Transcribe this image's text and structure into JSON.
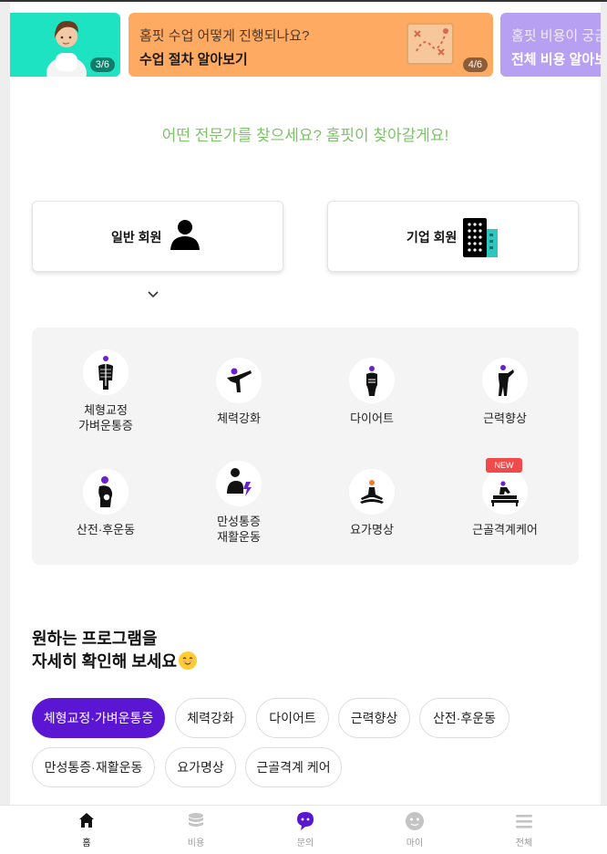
{
  "banners": [
    {
      "subtitle": "",
      "title": "",
      "pager": "3/6"
    },
    {
      "subtitle": "홈핏 수업 어떻게 진행되나요?",
      "title": "수업 절차 알아보기",
      "pager": "4/6"
    },
    {
      "subtitle": "홈핏 비용이 궁금",
      "title": "전체 비용 알아보",
      "pager": ""
    }
  ],
  "tagline": "어떤 전문가를 찾으세요? 홈핏이 찾아갈게요!",
  "member_types": [
    {
      "label": "일반 회원",
      "icon": "person-icon"
    },
    {
      "label": "기업 회원",
      "icon": "building-icon"
    }
  ],
  "categories": [
    {
      "label_line1": "체형교정",
      "label_line2": "가벼운통증",
      "icon": "posture-icon"
    },
    {
      "label_line1": "체력강화",
      "label_line2": "",
      "icon": "strength-icon"
    },
    {
      "label_line1": "다이어트",
      "label_line2": "",
      "icon": "diet-icon"
    },
    {
      "label_line1": "근력향상",
      "label_line2": "",
      "icon": "muscle-icon"
    },
    {
      "label_line1": "산전·후운동",
      "label_line2": "",
      "icon": "prenatal-icon"
    },
    {
      "label_line1": "만성통증",
      "label_line2": "재활운동",
      "icon": "chronic-pain-icon"
    },
    {
      "label_line1": "요가명상",
      "label_line2": "",
      "icon": "yoga-icon"
    },
    {
      "label_line1": "근골격계케어",
      "label_line2": "",
      "icon": "massage-icon",
      "badge": "NEW"
    }
  ],
  "program_section": {
    "title_line1": "원하는 프로그램을",
    "title_line2": "자세히 확인해 보세요"
  },
  "chips": [
    {
      "label": "체형교정·가벼운통증",
      "active": true
    },
    {
      "label": "체력강화"
    },
    {
      "label": "다이어트"
    },
    {
      "label": "근력향상"
    },
    {
      "label": "산전·후운동"
    },
    {
      "label": "만성통증·재활운동"
    },
    {
      "label": "요가명상"
    },
    {
      "label": "근골격계 케어"
    }
  ],
  "bottom_nav": [
    {
      "label": "홈",
      "icon": "home-icon",
      "active": true
    },
    {
      "label": "비용",
      "icon": "coins-icon"
    },
    {
      "label": "문의",
      "icon": "chat-icon"
    },
    {
      "label": "마이",
      "icon": "face-icon"
    },
    {
      "label": "전체",
      "icon": "menu-icon"
    }
  ],
  "colors": {
    "accent": "#5b16d4",
    "tagline": "#7fc26a",
    "banner_teal": "#1ee3c3",
    "banner_orange": "#ffaa63",
    "banner_purple": "#b7a0f2",
    "new_badge": "#f04a4a"
  }
}
